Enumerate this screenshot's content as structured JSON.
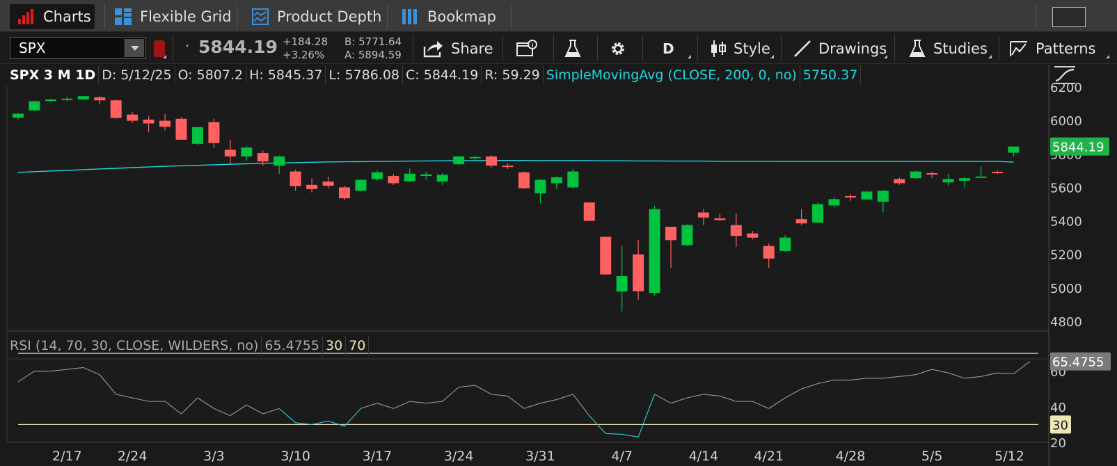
{
  "tabs": [
    {
      "label": "Charts",
      "icon": "bar-chart-icon"
    },
    {
      "label": "Flexible Grid",
      "icon": "grid-icon"
    },
    {
      "label": "Product Depth",
      "icon": "depth-icon"
    },
    {
      "label": "Bookmap",
      "icon": "bookmap-icon"
    }
  ],
  "toolbar": {
    "symbol": "SPX",
    "last": "5844.19",
    "change": "+184.28",
    "change_pct": "+3.26%",
    "bid": "B: 5771.64",
    "ask": "A: 5894.59",
    "share_label": "Share",
    "period": "D",
    "style_label": "Style",
    "drawings_label": "Drawings",
    "studies_label": "Studies",
    "patterns_label": "Patterns"
  },
  "info_bar": {
    "title": "SPX 3 M 1D",
    "date": "D: 5/12/25",
    "open": "O: 5807.2",
    "high": "H: 5845.37",
    "low": "L: 5786.08",
    "close": "C: 5844.19",
    "range": "R: 59.29",
    "study": "SimpleMovingAvg (CLOSE, 200, 0, no)",
    "study_value": "5750.37"
  },
  "rsi_bar": {
    "label": "RSI (14, 70, 30, CLOSE, WILDERS, no)",
    "value": "65.4755",
    "lower": "30",
    "upper": "70"
  },
  "colors": {
    "up": "#00c440",
    "down": "#ff6161",
    "sma": "#22d7e3",
    "rsi_line": "#9a9a9a",
    "rsi_oversold": "#22d7e3",
    "rsi_levels": "#f0e6b4",
    "price_tag": "#1fb34a"
  },
  "chart_data": [
    {
      "type": "candlestick",
      "ylim": [
        4800,
        6200
      ],
      "yticks": [
        "6200",
        "6000",
        "5800",
        "5600",
        "5400",
        "5200",
        "5000",
        "4800"
      ],
      "xticks": [
        "2/17",
        "2/24",
        "3/3",
        "3/10",
        "3/17",
        "3/24",
        "3/31",
        "4/7",
        "4/14",
        "4/21",
        "4/28",
        "5/5",
        "5/12"
      ],
      "last_price_tag": "5844.19",
      "candles": [
        {
          "o": 6016,
          "h": 6046,
          "l": 6005,
          "c": 6040
        },
        {
          "o": 6060,
          "h": 6115,
          "l": 6055,
          "c": 6115
        },
        {
          "o": 6120,
          "h": 6128,
          "l": 6110,
          "c": 6125
        },
        {
          "o": 6125,
          "h": 6140,
          "l": 6115,
          "c": 6130
        },
        {
          "o": 6125,
          "h": 6148,
          "l": 6120,
          "c": 6145
        },
        {
          "o": 6138,
          "h": 6145,
          "l": 6095,
          "c": 6120
        },
        {
          "o": 6120,
          "h": 6125,
          "l": 6010,
          "c": 6015
        },
        {
          "o": 6035,
          "h": 6050,
          "l": 5985,
          "c": 5998
        },
        {
          "o": 6005,
          "h": 6025,
          "l": 5930,
          "c": 5982
        },
        {
          "o": 5998,
          "h": 6038,
          "l": 5940,
          "c": 5962
        },
        {
          "o": 6010,
          "h": 6020,
          "l": 5885,
          "c": 5885
        },
        {
          "o": 5860,
          "h": 5962,
          "l": 5855,
          "c": 5960
        },
        {
          "o": 5990,
          "h": 6010,
          "l": 5835,
          "c": 5865
        },
        {
          "o": 5825,
          "h": 5885,
          "l": 5740,
          "c": 5785
        },
        {
          "o": 5785,
          "h": 5845,
          "l": 5760,
          "c": 5838
        },
        {
          "o": 5805,
          "h": 5820,
          "l": 5730,
          "c": 5755
        },
        {
          "o": 5730,
          "h": 5790,
          "l": 5680,
          "c": 5785
        },
        {
          "o": 5695,
          "h": 5705,
          "l": 5580,
          "c": 5608
        },
        {
          "o": 5615,
          "h": 5655,
          "l": 5570,
          "c": 5590
        },
        {
          "o": 5635,
          "h": 5665,
          "l": 5595,
          "c": 5610
        },
        {
          "o": 5600,
          "h": 5610,
          "l": 5525,
          "c": 5535
        },
        {
          "o": 5580,
          "h": 5650,
          "l": 5575,
          "c": 5645
        },
        {
          "o": 5650,
          "h": 5705,
          "l": 5640,
          "c": 5690
        },
        {
          "o": 5668,
          "h": 5680,
          "l": 5615,
          "c": 5625
        },
        {
          "o": 5637,
          "h": 5712,
          "l": 5632,
          "c": 5682
        },
        {
          "o": 5668,
          "h": 5695,
          "l": 5645,
          "c": 5678
        },
        {
          "o": 5635,
          "h": 5685,
          "l": 5615,
          "c": 5675
        },
        {
          "o": 5738,
          "h": 5790,
          "l": 5732,
          "c": 5785
        },
        {
          "o": 5776,
          "h": 5788,
          "l": 5765,
          "c": 5782
        },
        {
          "o": 5785,
          "h": 5792,
          "l": 5720,
          "c": 5730
        },
        {
          "o": 5730,
          "h": 5745,
          "l": 5710,
          "c": 5725
        },
        {
          "o": 5690,
          "h": 5695,
          "l": 5590,
          "c": 5595
        },
        {
          "o": 5565,
          "h": 5650,
          "l": 5505,
          "c": 5645
        },
        {
          "o": 5625,
          "h": 5665,
          "l": 5590,
          "c": 5660
        },
        {
          "o": 5600,
          "h": 5710,
          "l": 5595,
          "c": 5695
        },
        {
          "o": 5510,
          "h": 5510,
          "l": 5400,
          "c": 5400
        },
        {
          "o": 5305,
          "h": 5305,
          "l": 5080,
          "c": 5080
        },
        {
          "o": 4978,
          "h": 5250,
          "l": 4860,
          "c": 5070
        },
        {
          "o": 5200,
          "h": 5285,
          "l": 4930,
          "c": 4980
        },
        {
          "o": 4970,
          "h": 5490,
          "l": 4955,
          "c": 5470
        },
        {
          "o": 5365,
          "h": 5365,
          "l": 5120,
          "c": 5285
        },
        {
          "o": 5255,
          "h": 5380,
          "l": 5250,
          "c": 5375
        },
        {
          "o": 5450,
          "h": 5470,
          "l": 5375,
          "c": 5420
        },
        {
          "o": 5415,
          "h": 5440,
          "l": 5400,
          "c": 5405
        },
        {
          "o": 5375,
          "h": 5445,
          "l": 5245,
          "c": 5310
        },
        {
          "o": 5325,
          "h": 5340,
          "l": 5290,
          "c": 5300
        },
        {
          "o": 5250,
          "h": 5265,
          "l": 5120,
          "c": 5175
        },
        {
          "o": 5220,
          "h": 5315,
          "l": 5215,
          "c": 5300
        },
        {
          "o": 5410,
          "h": 5470,
          "l": 5375,
          "c": 5385
        },
        {
          "o": 5390,
          "h": 5510,
          "l": 5385,
          "c": 5500
        },
        {
          "o": 5492,
          "h": 5540,
          "l": 5480,
          "c": 5530
        },
        {
          "o": 5548,
          "h": 5560,
          "l": 5520,
          "c": 5545
        },
        {
          "o": 5528,
          "h": 5580,
          "l": 5522,
          "c": 5575
        },
        {
          "o": 5515,
          "h": 5585,
          "l": 5450,
          "c": 5580
        },
        {
          "o": 5650,
          "h": 5660,
          "l": 5615,
          "c": 5625
        },
        {
          "o": 5655,
          "h": 5700,
          "l": 5650,
          "c": 5695
        },
        {
          "o": 5685,
          "h": 5695,
          "l": 5655,
          "c": 5680
        },
        {
          "o": 5630,
          "h": 5680,
          "l": 5610,
          "c": 5650
        },
        {
          "o": 5640,
          "h": 5660,
          "l": 5600,
          "c": 5655
        },
        {
          "o": 5663,
          "h": 5725,
          "l": 5660,
          "c": 5665
        },
        {
          "o": 5693,
          "h": 5705,
          "l": 5680,
          "c": 5685
        },
        {
          "o": 5807,
          "h": 5845,
          "l": 5786,
          "c": 5844
        }
      ],
      "sma": [
        5690,
        5694,
        5698,
        5702,
        5706,
        5710,
        5714,
        5718,
        5722,
        5726,
        5729,
        5732,
        5735,
        5738,
        5741,
        5744,
        5746,
        5748,
        5750,
        5752,
        5753,
        5754,
        5755,
        5756,
        5757,
        5758,
        5759,
        5760,
        5760,
        5761,
        5761,
        5761,
        5760,
        5760,
        5760,
        5760,
        5759,
        5759,
        5758,
        5758,
        5757,
        5757,
        5757,
        5756,
        5756,
        5756,
        5756,
        5755,
        5755,
        5755,
        5755,
        5755,
        5755,
        5755,
        5755,
        5755,
        5755,
        5755,
        5755,
        5755,
        5755,
        5751
      ]
    },
    {
      "type": "line",
      "name": "RSI",
      "ylim": [
        20,
        65
      ],
      "yticks": [
        "60",
        "40",
        "20"
      ],
      "levels": [
        30,
        70
      ],
      "values": [
        54,
        60,
        60,
        61,
        62,
        58,
        47,
        45,
        43,
        43,
        36,
        45,
        39,
        35,
        41,
        36,
        39,
        31,
        30,
        32,
        29,
        39,
        42,
        39,
        43,
        42,
        43,
        51,
        52,
        47,
        46,
        39,
        42,
        44,
        47,
        35,
        25,
        24.5,
        23,
        47,
        42,
        45,
        47,
        46,
        43,
        43,
        39,
        45,
        50,
        53,
        55,
        55,
        56,
        56,
        57,
        58,
        61,
        59,
        56,
        57,
        59,
        58.5,
        65.48
      ]
    }
  ]
}
